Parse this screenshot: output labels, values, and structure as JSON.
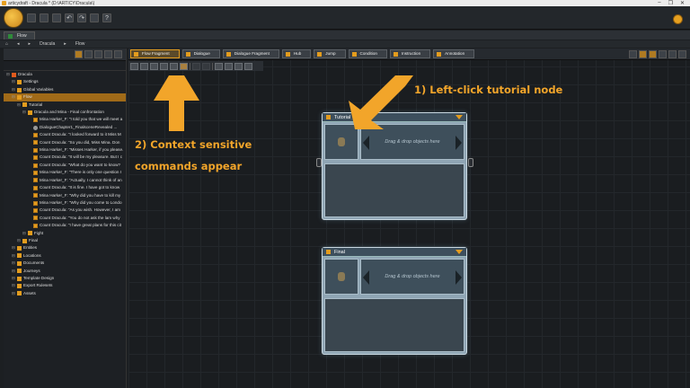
{
  "window": {
    "title": "articydraft - Dracula * (D:\\ARTICY\\Dracula\\)",
    "controls": [
      "–",
      "❐",
      "✕"
    ]
  },
  "tabs": [
    {
      "label": "Flow"
    }
  ],
  "breadcrumb": {
    "items": [
      "Dracula",
      "Flow"
    ]
  },
  "tree": {
    "items": [
      {
        "label": "Dracula",
        "depth": 0,
        "icon": "root"
      },
      {
        "label": "Settings",
        "depth": 1,
        "icon": "folder"
      },
      {
        "label": "Global Variables",
        "depth": 1,
        "icon": "folder"
      },
      {
        "label": "Flow",
        "depth": 1,
        "icon": "folder",
        "selected": true
      },
      {
        "label": "Tutorial",
        "depth": 2,
        "icon": "folder"
      },
      {
        "label": "Dracula and Mina - Final confrontation",
        "depth": 3,
        "icon": "folder"
      },
      {
        "label": "Mina Harker_F: \"I told you that we will meet a",
        "depth": 4,
        "icon": "page"
      },
      {
        "label": "DialogueChapter1_FinalsceneRevealed ...",
        "depth": 4,
        "icon": "cond"
      },
      {
        "label": "Count Dracula: \"I looked forward to it Miss M",
        "depth": 4,
        "icon": "page"
      },
      {
        "label": "Count Dracula: \"So you did, Miss Mina. Don",
        "depth": 4,
        "icon": "page"
      },
      {
        "label": "Mina Harker_F: \"Misses Harker, if you please.",
        "depth": 4,
        "icon": "page"
      },
      {
        "label": "Count Dracula: \"It will be my pleasure. But I c",
        "depth": 4,
        "icon": "page"
      },
      {
        "label": "Count Dracula: \"What do you want to know?",
        "depth": 4,
        "icon": "page"
      },
      {
        "label": "Mina Harker_F: \"There is only one question I",
        "depth": 4,
        "icon": "page"
      },
      {
        "label": "Mina Harker_F: \"Actually, I cannot think of an",
        "depth": 4,
        "icon": "page"
      },
      {
        "label": "Count Dracula: \"It is fine. I have got to know",
        "depth": 4,
        "icon": "page"
      },
      {
        "label": "Mina Harker_F: \"Why did you have to kill my",
        "depth": 4,
        "icon": "page"
      },
      {
        "label": "Mina Harker_F: \"Why did you come to Londo",
        "depth": 4,
        "icon": "page"
      },
      {
        "label": "Count Dracula: \"As you wish. However, I am",
        "depth": 4,
        "icon": "page"
      },
      {
        "label": "Count Dracula: \"You do not ask the lam why",
        "depth": 4,
        "icon": "page"
      },
      {
        "label": "Count Dracula: \"I have great plans for this cit",
        "depth": 4,
        "icon": "page"
      },
      {
        "label": "Fight",
        "depth": 3,
        "icon": "folder"
      },
      {
        "label": "Final",
        "depth": 2,
        "icon": "folder"
      },
      {
        "label": "Entities",
        "depth": 1,
        "icon": "folder"
      },
      {
        "label": "Locations",
        "depth": 1,
        "icon": "folder"
      },
      {
        "label": "Documents",
        "depth": 1,
        "icon": "folder"
      },
      {
        "label": "Journeys",
        "depth": 1,
        "icon": "folder"
      },
      {
        "label": "Template Design",
        "depth": 1,
        "icon": "folder"
      },
      {
        "label": "Export Rulesets",
        "depth": 1,
        "icon": "folder"
      },
      {
        "label": "Assets",
        "depth": 1,
        "icon": "folder"
      }
    ]
  },
  "commands": [
    {
      "label": "Flow Fragment"
    },
    {
      "label": "Dialogue"
    },
    {
      "label": "Dialogue Fragment"
    },
    {
      "label": "Hub"
    },
    {
      "label": "Jump"
    },
    {
      "label": "Condition"
    },
    {
      "label": "Instruction"
    },
    {
      "label": "Annotation"
    }
  ],
  "nodes": [
    {
      "title": "Tutorial",
      "drop_text": "Drag & drop objects here"
    },
    {
      "title": "Final",
      "drop_text": "Drag & drop objects here"
    }
  ],
  "annotations": {
    "step1": "1) Left-click tutorial node",
    "step2_line1": "2) Context sensitive",
    "step2_line2": "commands appear"
  },
  "colors": {
    "accent": "#f2a52a",
    "node_border": "#c8d7e0",
    "background": "#1a1d20"
  }
}
